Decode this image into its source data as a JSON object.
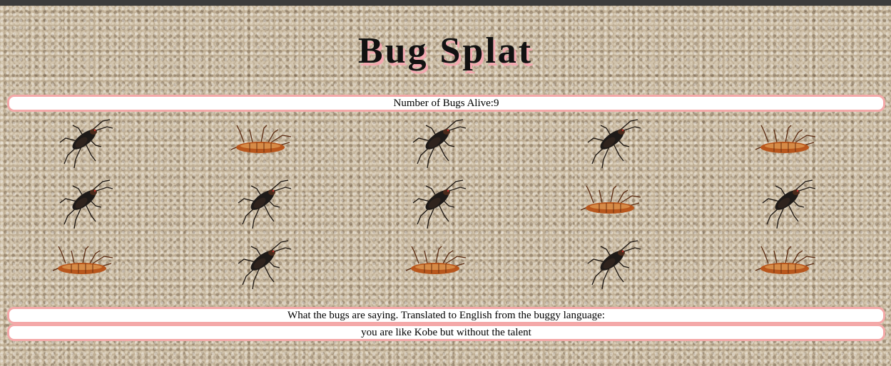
{
  "title": "Bug Splat",
  "status": {
    "label": "Number of Bugs Alive:",
    "count": "9"
  },
  "saying": {
    "title": "What the bugs are saying. Translated to English from the buggy language:",
    "text": "you are like Kobe but without the talent"
  },
  "bugs": [
    {
      "row": 1,
      "col": 1,
      "state": "alive"
    },
    {
      "row": 1,
      "col": 2,
      "state": "dead"
    },
    {
      "row": 1,
      "col": 3,
      "state": "alive"
    },
    {
      "row": 1,
      "col": 4,
      "state": "alive"
    },
    {
      "row": 1,
      "col": 5,
      "state": "dead"
    },
    {
      "row": 2,
      "col": 1,
      "state": "alive"
    },
    {
      "row": 2,
      "col": 2,
      "state": "alive"
    },
    {
      "row": 2,
      "col": 3,
      "state": "alive"
    },
    {
      "row": 2,
      "col": 4,
      "state": "dead"
    },
    {
      "row": 2,
      "col": 5,
      "state": "alive"
    },
    {
      "row": 3,
      "col": 1,
      "state": "dead"
    },
    {
      "row": 3,
      "col": 2,
      "state": "alive"
    },
    {
      "row": 3,
      "col": 3,
      "state": "dead"
    },
    {
      "row": 3,
      "col": 4,
      "state": "alive"
    },
    {
      "row": 3,
      "col": 5,
      "state": "dead"
    }
  ],
  "colors": {
    "panel_border": "#f4a8a8",
    "title_shadow": "#f4a8b0",
    "alive_bug": "#1e1a18",
    "dead_bug": "#b8561c"
  }
}
